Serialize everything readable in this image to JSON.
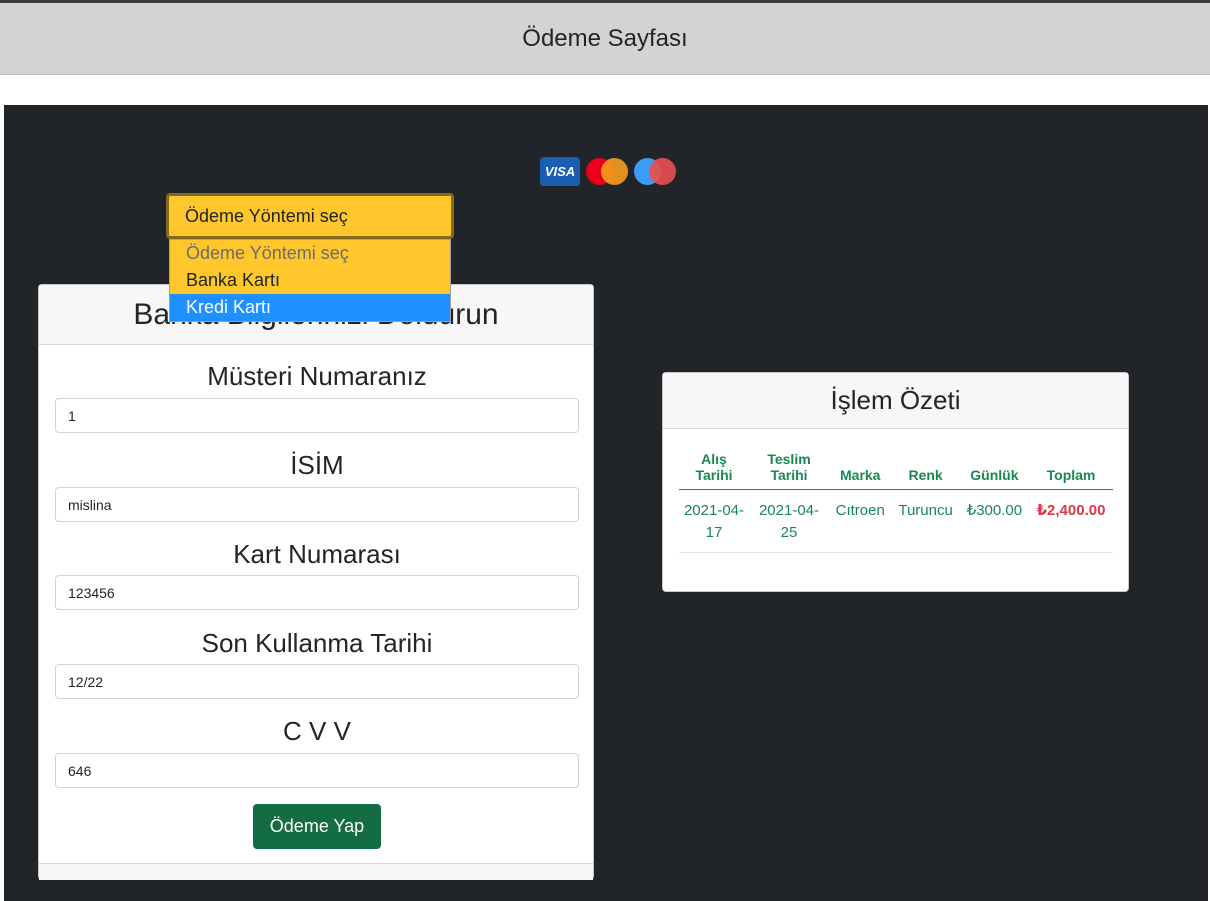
{
  "header": {
    "title": "Ödeme Sayfası"
  },
  "card_logos": [
    "visa-logo",
    "mastercard-logo",
    "maestro-logo"
  ],
  "payment_select": {
    "selected": "Ödeme Yöntemi seç",
    "options": [
      "Ödeme Yöntemi seç",
      "Banka Kartı",
      "Kredi Kartı"
    ],
    "highlighted": "Kredi Kartı"
  },
  "form": {
    "title": "Banka Bilgilerinizi Doldurun",
    "fields": [
      {
        "label": "Müsteri Numaranız",
        "value": "1"
      },
      {
        "label": "İSİM",
        "value": "mislina"
      },
      {
        "label": "Kart Numarası",
        "value": "123456"
      },
      {
        "label": "Son Kullanma Tarihi",
        "value": "12/22"
      },
      {
        "label": "C V V",
        "value": "646"
      }
    ],
    "submit_label": "Ödeme Yap"
  },
  "summary": {
    "title": "İşlem Özeti",
    "columns": [
      "Alış Tarihi",
      "Teslim Tarihi",
      "Marka",
      "Renk",
      "Günlük",
      "Toplam"
    ],
    "rows": [
      [
        "2021-04-17",
        "2021-04-25",
        "Cıtroen",
        "Turuncu",
        "₺300.00",
        "₺2,400.00"
      ]
    ]
  },
  "colors": {
    "accent_yellow": "#ffc72c",
    "button_green": "#146c43",
    "table_green": "#198754",
    "total_red": "#dc3545",
    "background_dark": "#212529"
  }
}
